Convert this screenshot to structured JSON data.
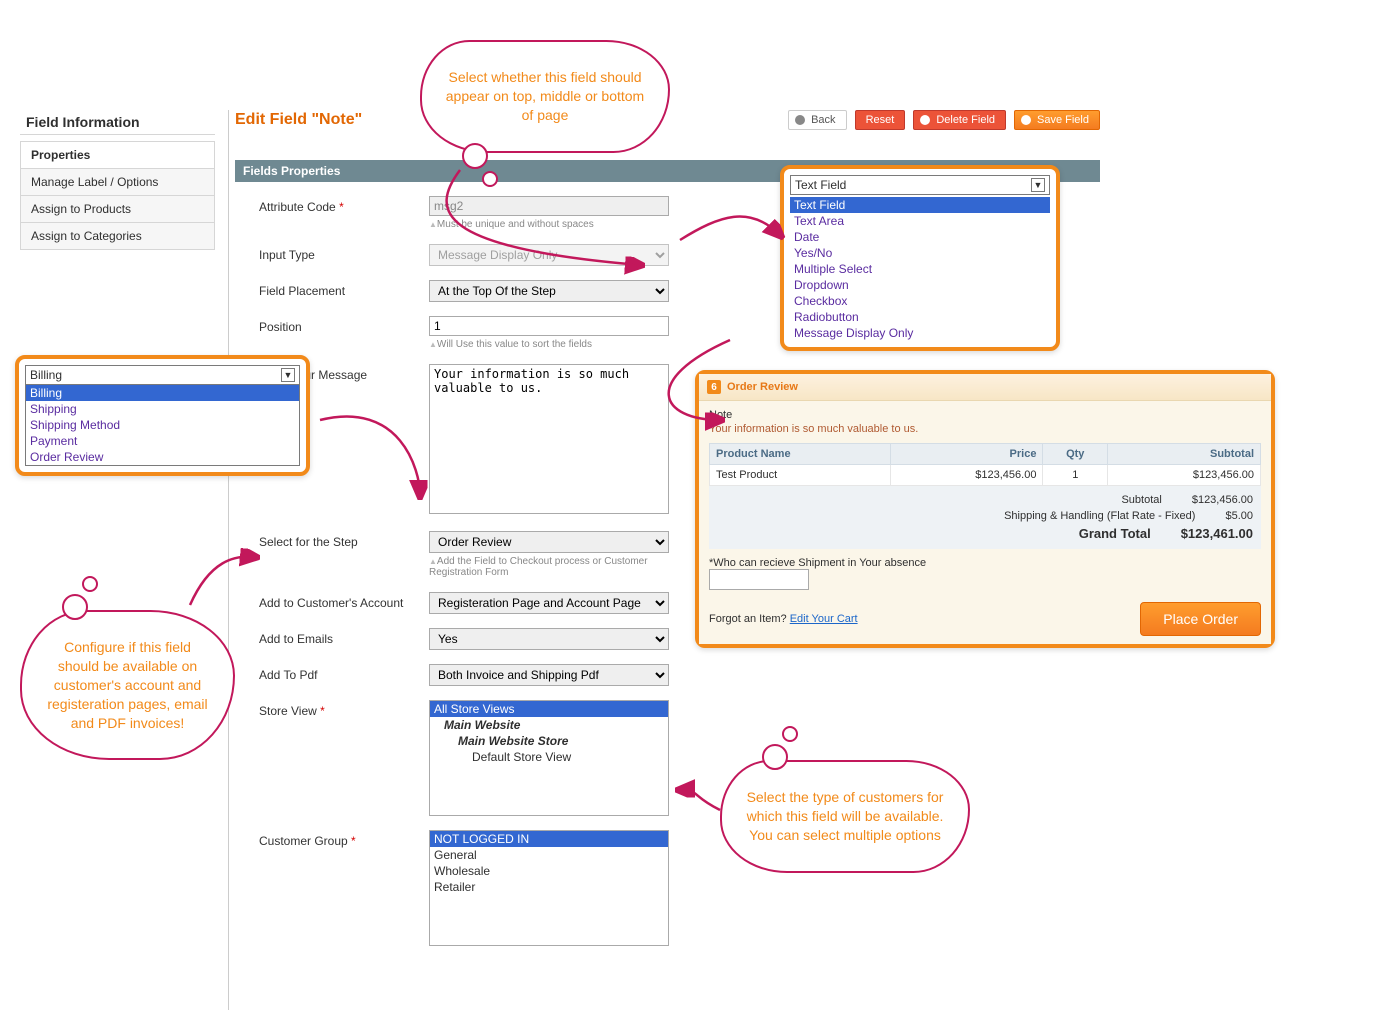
{
  "sidebar": {
    "title": "Field Information",
    "items": [
      "Properties",
      "Manage Label / Options",
      "Assign to Products",
      "Assign to Categories"
    ]
  },
  "header": {
    "title": "Edit Field \"Note\"",
    "back": "Back",
    "reset": "Reset",
    "delete": "Delete Field",
    "save": "Save Field"
  },
  "section": {
    "title": "Fields Properties"
  },
  "form": {
    "attrcode": {
      "label": "Attribute Code",
      "value": "msg2",
      "hint": "Must be unique and without spaces"
    },
    "inputtype": {
      "label": "Input Type",
      "value": "Message Display Only"
    },
    "placement": {
      "label": "Field Placement",
      "value": "At the Top Of the Step"
    },
    "position": {
      "label": "Position",
      "value": "1",
      "hint": "Will Use this value to sort the fields"
    },
    "message": {
      "label": "Enter Your Message",
      "value": "Your information is so much valuable to us."
    },
    "step": {
      "label": "Select for the Step",
      "value": "Order Review",
      "hint": "Add the Field to Checkout process or Customer Registration Form"
    },
    "account": {
      "label": "Add to Customer's Account",
      "value": "Registeration Page and Account Page"
    },
    "emails": {
      "label": "Add to Emails",
      "value": "Yes"
    },
    "pdf": {
      "label": "Add To Pdf",
      "value": "Both Invoice and Shipping Pdf"
    },
    "storeview": {
      "label": "Store View",
      "options": [
        "All Store Views",
        "Main Website",
        "Main Website Store",
        "Default Store View"
      ],
      "selected": "All Store Views"
    },
    "custgroup": {
      "label": "Customer Group",
      "options": [
        "NOT LOGGED IN",
        "General",
        "Wholesale",
        "Retailer"
      ],
      "selected": "NOT LOGGED IN"
    }
  },
  "thoughts": {
    "placement": "Select whether this field should appear on top, middle or bottom of page",
    "account": "Configure if this field should be available on customer's account and registeration pages, email and PDF invoices!",
    "custgroup": "Select the type of customers for which this field will be available. You can select multiple options"
  },
  "inputtype_dropdown": {
    "selected": "Text Field",
    "options": [
      "Text Field",
      "Text Area",
      "Date",
      "Yes/No",
      "Multiple Select",
      "Dropdown",
      "Checkbox",
      "Radiobutton",
      "Message Display Only"
    ]
  },
  "step_dropdown": {
    "selected": "Billing",
    "options": [
      "Billing",
      "Shipping",
      "Shipping Method",
      "Payment",
      "Order Review"
    ]
  },
  "order_review": {
    "title": "Order Review",
    "step_no": "6",
    "note_title": "Note",
    "note_msg": "Your information is so much valuable to us.",
    "cols": {
      "name": "Product Name",
      "price": "Price",
      "qty": "Qty",
      "subtotal": "Subtotal"
    },
    "row": {
      "name": "Test Product",
      "price": "$123,456.00",
      "qty": "1",
      "subtotal": "$123,456.00"
    },
    "totals": {
      "subtotal_l": "Subtotal",
      "subtotal_v": "$123,456.00",
      "ship_l": "Shipping & Handling (Flat Rate - Fixed)",
      "ship_v": "$5.00",
      "grand_l": "Grand Total",
      "grand_v": "$123,461.00"
    },
    "question": "*Who can recieve Shipment in Your absence",
    "forgot_pre": "Forgot an Item? ",
    "forgot_link": "Edit Your Cart",
    "place": "Place Order"
  }
}
